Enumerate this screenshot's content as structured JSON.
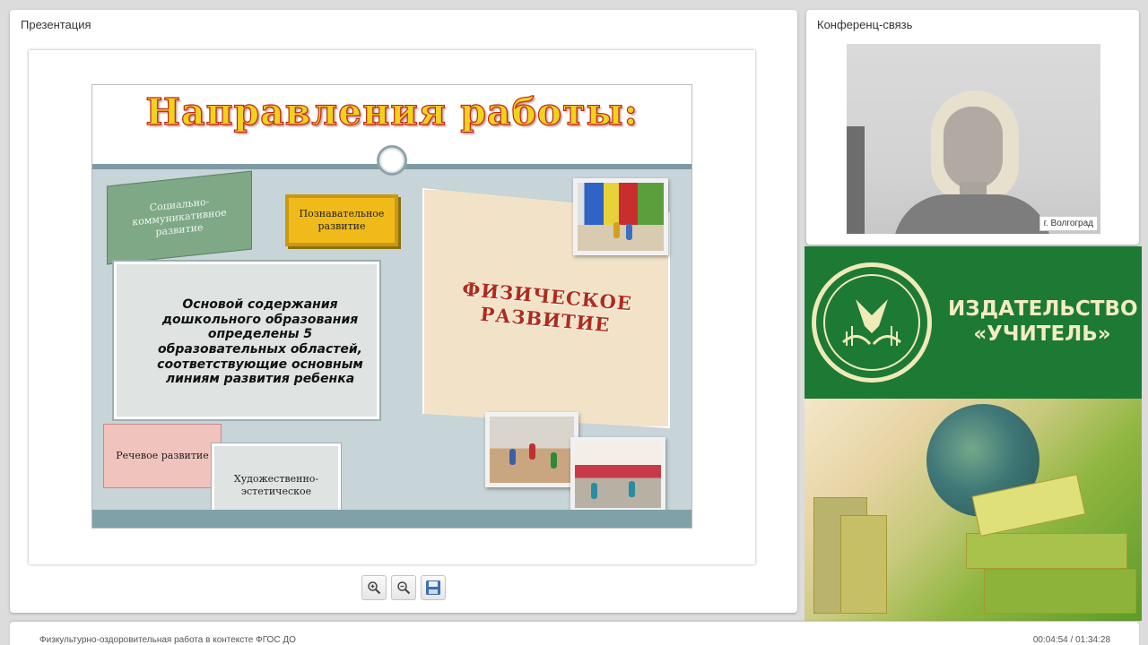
{
  "presentation_panel": {
    "title": "Презентация",
    "slide": {
      "heading": "Направления работы:",
      "box_social": "Социально-коммуникативное развитие",
      "box_cognitive": "Познавательное развитие",
      "box_main": "Основой содержания дошкольного образования определены 5 образовательных областей, соответствующие основным линиям развития ребенка",
      "box_speech": "Речевое развитие",
      "box_art": "Художественно-эстетическое",
      "box_physical": "ФИЗИЧЕСКОЕ РАЗВИТИЕ"
    },
    "toolbar": {
      "zoom_in_icon": "zoom-in-icon",
      "zoom_out_icon": "zoom-out-icon",
      "save_icon": "save-icon"
    }
  },
  "conference_panel": {
    "title": "Конференц-связь",
    "video_label": "г. Волгоград"
  },
  "ad_banner": {
    "line1": "ИЗДАТЕЛЬСТВО",
    "line2": "«УЧИТЕЛЬ»",
    "colors": {
      "green": "#1c7a35",
      "cream": "#f3ecc0"
    }
  },
  "footer": {
    "webinar_title": "Физкультурно-оздоровительная работа в контексте ФГОС ДО",
    "time": "00:04:54 / 01:34:28"
  }
}
